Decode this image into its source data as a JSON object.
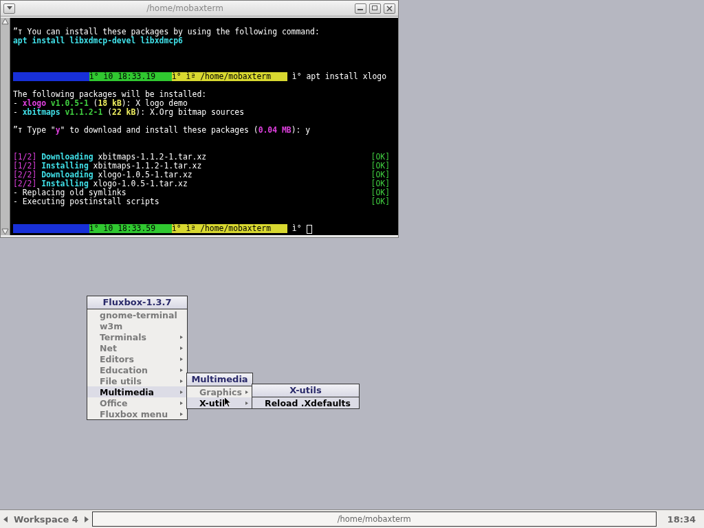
{
  "terminal": {
    "title": "/home/mobaxterm",
    "lines": [
      {
        "kind": "text",
        "segments": [
          {
            "text": "”т You can install these packages by using the following command:",
            "color": "#ffffff"
          }
        ]
      },
      {
        "kind": "text",
        "segments": [
          {
            "text": "apt install libxdmcp-devel libxdmcp6",
            "color": "#40e0e8",
            "bold": true
          }
        ]
      },
      {
        "kind": "blank"
      },
      {
        "kind": "blank"
      },
      {
        "kind": "blank"
      },
      {
        "kind": "prompt",
        "clock": "ì° ì0 18:33.19",
        "path": "ì° ìª /home/mobaxterm",
        "command": "ì° apt install xlogo",
        "cursor": false
      },
      {
        "kind": "blank"
      },
      {
        "kind": "text",
        "segments": [
          {
            "text": "The following packages will be installed:",
            "color": "#ffffff"
          }
        ]
      },
      {
        "kind": "text",
        "segments": [
          {
            "text": "- "
          },
          {
            "text": "xlogo",
            "color": "#e040e0",
            "bold": true
          },
          {
            "text": " v1.0.5-1",
            "color": "#40d040",
            "bold": true
          },
          {
            "text": " ("
          },
          {
            "text": "18 kB",
            "color": "#f0f060",
            "bold": true
          },
          {
            "text": "): X logo demo",
            "color": "#ffffff"
          }
        ]
      },
      {
        "kind": "text",
        "segments": [
          {
            "text": "- "
          },
          {
            "text": "xbitmaps",
            "color": "#40e0e8",
            "bold": true
          },
          {
            "text": " v1.1.2-1",
            "color": "#40d040",
            "bold": true
          },
          {
            "text": " ("
          },
          {
            "text": "22 kB",
            "color": "#f0f060",
            "bold": true
          },
          {
            "text": "): X.Org bitmap sources",
            "color": "#ffffff"
          }
        ]
      },
      {
        "kind": "blank"
      },
      {
        "kind": "text",
        "segments": [
          {
            "text": "”т Type \"",
            "color": "#ffffff"
          },
          {
            "text": "y",
            "color": "#e040e0",
            "bold": true
          },
          {
            "text": "\" to download and install these packages (",
            "color": "#ffffff"
          },
          {
            "text": "0.04 MB",
            "color": "#e040e0",
            "bold": true
          },
          {
            "text": "): y",
            "color": "#ffffff"
          }
        ]
      },
      {
        "kind": "blank"
      },
      {
        "kind": "blank"
      },
      {
        "kind": "text",
        "status": "[OK]",
        "segments": [
          {
            "text": "[1/2] ",
            "color": "#e040e0"
          },
          {
            "text": "Downloading",
            "color": "#40e0e8",
            "bold": true
          },
          {
            "text": " xbitmaps-1.1.2-1.tar.xz",
            "color": "#ffffff"
          }
        ]
      },
      {
        "kind": "text",
        "status": "[OK]",
        "segments": [
          {
            "text": "[1/2] ",
            "color": "#e040e0"
          },
          {
            "text": "Installing",
            "color": "#40e0e8",
            "bold": true
          },
          {
            "text": " xbitmaps-1.1.2-1.tar.xz",
            "color": "#ffffff"
          }
        ]
      },
      {
        "kind": "text",
        "status": "[OK]",
        "segments": [
          {
            "text": "[2/2] ",
            "color": "#e040e0"
          },
          {
            "text": "Downloading",
            "color": "#40e0e8",
            "bold": true
          },
          {
            "text": " xlogo-1.0.5-1.tar.xz",
            "color": "#ffffff"
          }
        ]
      },
      {
        "kind": "text",
        "status": "[OK]",
        "segments": [
          {
            "text": "[2/2] ",
            "color": "#e040e0"
          },
          {
            "text": "Installing",
            "color": "#40e0e8",
            "bold": true
          },
          {
            "text": " xlogo-1.0.5-1.tar.xz",
            "color": "#ffffff"
          }
        ]
      },
      {
        "kind": "text",
        "status": "[OK]",
        "segments": [
          {
            "text": "- Replacing old symlinks",
            "color": "#ffffff"
          }
        ]
      },
      {
        "kind": "text",
        "status": "[OK]",
        "segments": [
          {
            "text": "- Executing postinstall scripts",
            "color": "#ffffff"
          }
        ]
      },
      {
        "kind": "blank"
      },
      {
        "kind": "blank"
      },
      {
        "kind": "prompt",
        "clock": "ì° ì0 18:33.59",
        "path": "ì° ìª /home/mobaxterm",
        "command": "ì°",
        "cursor": true
      }
    ]
  },
  "menus": [
    {
      "title": "Fluxbox-1.3.7",
      "items": [
        {
          "label": "gnome-terminal",
          "submenu": false,
          "selected": false
        },
        {
          "label": "w3m",
          "submenu": false,
          "selected": false
        },
        {
          "label": "Terminals",
          "submenu": true,
          "selected": false
        },
        {
          "label": "Net",
          "submenu": true,
          "selected": false
        },
        {
          "label": "Editors",
          "submenu": true,
          "selected": false
        },
        {
          "label": "Education",
          "submenu": true,
          "selected": false
        },
        {
          "label": "File utils",
          "submenu": true,
          "selected": false
        },
        {
          "label": "Multimedia",
          "submenu": true,
          "selected": true
        },
        {
          "label": "Office",
          "submenu": true,
          "selected": false
        },
        {
          "label": "Fluxbox menu",
          "submenu": true,
          "selected": false
        }
      ]
    },
    {
      "title": "Multimedia",
      "items": [
        {
          "label": "Graphics",
          "submenu": true,
          "selected": false
        },
        {
          "label": "X-util",
          "submenu": true,
          "selected": true
        }
      ]
    },
    {
      "title": "X-utils",
      "items": [
        {
          "label": "Reload .Xdefaults",
          "submenu": false,
          "selected": true
        }
      ]
    }
  ],
  "taskbar": {
    "workspace": "Workspace 4",
    "window": "/home/mobaxterm",
    "clock": "18:34"
  }
}
